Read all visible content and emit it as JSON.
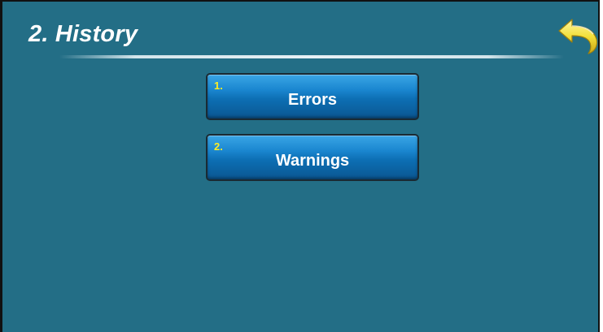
{
  "header": {
    "title": "2. History",
    "back_icon": "back-arrow-icon"
  },
  "menu": {
    "items": [
      {
        "number": "1.",
        "label": "Errors"
      },
      {
        "number": "2.",
        "label": "Warnings"
      }
    ]
  },
  "colors": {
    "background": "#236e86",
    "button_gradient_top": "#3aa6e6",
    "button_gradient_bottom": "#0a5691",
    "number_color": "#ffee22",
    "label_color": "#ffffff",
    "back_icon_color": "#f2df3a"
  }
}
